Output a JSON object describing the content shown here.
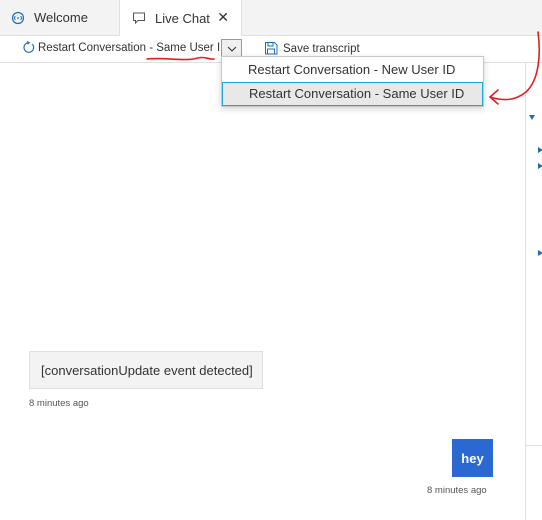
{
  "tabs": [
    {
      "label": "Welcome",
      "icon": "welcome-icon"
    },
    {
      "label": "Live Chat",
      "icon": "chat-icon",
      "active": true,
      "close_glyph": "✕"
    }
  ],
  "toolbar": {
    "restart_label": "Restart Conversation - Same User ID",
    "save_label": "Save transcript"
  },
  "menu": {
    "items": [
      {
        "label": "Restart Conversation - New User ID"
      },
      {
        "label": "Restart Conversation - Same User ID",
        "highlighted": true
      }
    ]
  },
  "chat": {
    "event_text": "[conversationUpdate event detected]",
    "event_time": "8 minutes ago",
    "user_message": "hey",
    "user_time": "8 minutes ago"
  },
  "colors": {
    "accent": "#1aa9d6",
    "user_bubble": "#2a69d1",
    "annotation": "#e02020"
  }
}
